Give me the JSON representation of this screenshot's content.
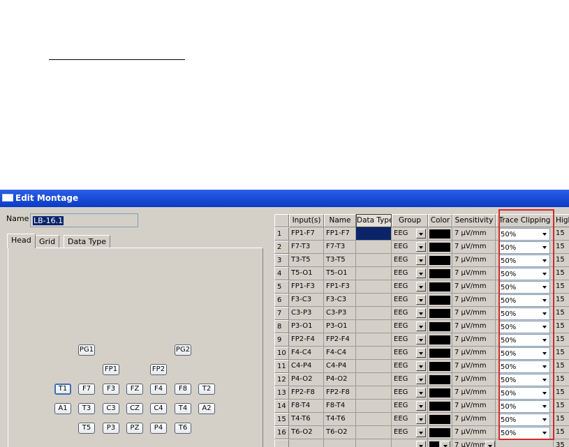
{
  "window": {
    "title": "Edit Montage"
  },
  "name_field": {
    "label": "Name",
    "value": "LB-16.1"
  },
  "tabs": [
    {
      "label": "Head"
    },
    {
      "label": "Grid"
    },
    {
      "label": "Data Type"
    }
  ],
  "electrodes": [
    "PG1",
    "PG2",
    "FP1",
    "FP2",
    "T1",
    "F7",
    "F3",
    "FZ",
    "F4",
    "F8",
    "T2",
    "A1",
    "T3",
    "C3",
    "CZ",
    "C4",
    "T4",
    "A2",
    "T5",
    "P3",
    "PZ",
    "P4",
    "T6"
  ],
  "columns": [
    "Input(s)",
    "Name",
    "Data Type",
    "Group",
    "Color",
    "Sensitivity",
    "Trace Clipping",
    "High"
  ],
  "rows": [
    {
      "n": "1",
      "input": "FP1-F7",
      "name": "FP1-F7",
      "group": "EEG",
      "sens": "7 μV/mm",
      "clip": "50%",
      "high": "15"
    },
    {
      "n": "2",
      "input": "F7-T3",
      "name": "F7-T3",
      "group": "EEG",
      "sens": "7 μV/mm",
      "clip": "50%",
      "high": "15"
    },
    {
      "n": "3",
      "input": "T3-T5",
      "name": "T3-T5",
      "group": "EEG",
      "sens": "7 μV/mm",
      "clip": "50%",
      "high": "15"
    },
    {
      "n": "4",
      "input": "T5-O1",
      "name": "T5-O1",
      "group": "EEG",
      "sens": "7 μV/mm",
      "clip": "50%",
      "high": "15"
    },
    {
      "n": "5",
      "input": "FP1-F3",
      "name": "FP1-F3",
      "group": "EEG",
      "sens": "7 μV/mm",
      "clip": "50%",
      "high": "15"
    },
    {
      "n": "6",
      "input": "F3-C3",
      "name": "F3-C3",
      "group": "EEG",
      "sens": "7 μV/mm",
      "clip": "50%",
      "high": "15"
    },
    {
      "n": "7",
      "input": "C3-P3",
      "name": "C3-P3",
      "group": "EEG",
      "sens": "7 μV/mm",
      "clip": "50%",
      "high": "15"
    },
    {
      "n": "8",
      "input": "P3-O1",
      "name": "P3-O1",
      "group": "EEG",
      "sens": "7 μV/mm",
      "clip": "50%",
      "high": "15"
    },
    {
      "n": "9",
      "input": "FP2-F4",
      "name": "FP2-F4",
      "group": "EEG",
      "sens": "7 μV/mm",
      "clip": "50%",
      "high": "15"
    },
    {
      "n": "10",
      "input": "F4-C4",
      "name": "F4-C4",
      "group": "EEG",
      "sens": "7 μV/mm",
      "clip": "50%",
      "high": "15"
    },
    {
      "n": "11",
      "input": "C4-P4",
      "name": "C4-P4",
      "group": "EEG",
      "sens": "7 μV/mm",
      "clip": "50%",
      "high": "15"
    },
    {
      "n": "12",
      "input": "P4-O2",
      "name": "P4-O2",
      "group": "EEG",
      "sens": "7 μV/mm",
      "clip": "50%",
      "high": "15"
    },
    {
      "n": "13",
      "input": "FP2-F8",
      "name": "FP2-F8",
      "group": "EEG",
      "sens": "7 μV/mm",
      "clip": "50%",
      "high": "15"
    },
    {
      "n": "14",
      "input": "F8-T4",
      "name": "F8-T4",
      "group": "EEG",
      "sens": "7 μV/mm",
      "clip": "50%",
      "high": "15"
    },
    {
      "n": "15",
      "input": "T4-T6",
      "name": "T4-T6",
      "group": "EEG",
      "sens": "7 μV/mm",
      "clip": "50%",
      "high": "15"
    },
    {
      "n": "16",
      "input": "T6-O2",
      "name": "T6-O2",
      "group": "EEG",
      "sens": "7 μV/mm",
      "clip": "50%",
      "high": "15"
    }
  ],
  "new_row": {
    "sens": "7 μV/mm",
    "high": "35"
  },
  "colors": {
    "title_bar": "#0a3bc4",
    "selected_cell": "#0a246a",
    "highlight_box": "#d42a2a",
    "trace_color": "#000000"
  }
}
